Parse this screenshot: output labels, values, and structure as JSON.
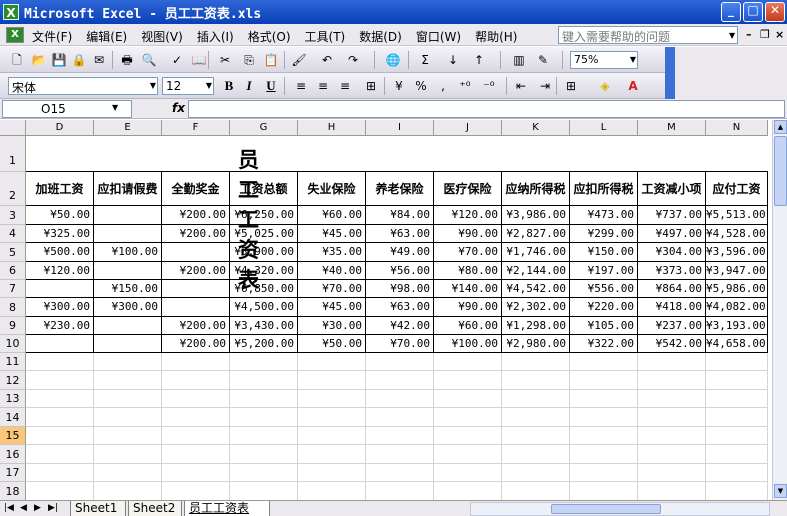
{
  "window": {
    "title": "Microsoft Excel - 员工工资表.xls",
    "icon_glyph": "X",
    "minimize_glyph": "_",
    "maximize_glyph": "□",
    "close_glyph": "✕"
  },
  "menu": {
    "items": [
      "文件(F)",
      "编辑(E)",
      "视图(V)",
      "插入(I)",
      "格式(O)",
      "工具(T)",
      "数据(D)",
      "窗口(W)",
      "帮助(H)"
    ],
    "help_placeholder": "键入需要帮助的问题",
    "mdi_minimize": "–",
    "mdi_restore": "❐",
    "mdi_close": "×"
  },
  "toolbar": {
    "zoom": "75%",
    "font": "宋体",
    "font_size": "12",
    "standard_icons": [
      {
        "name": "new-icon",
        "glyph": "🗋"
      },
      {
        "name": "open-icon",
        "glyph": "📂"
      },
      {
        "name": "save-icon",
        "glyph": "💾"
      },
      {
        "name": "permission-icon",
        "glyph": "🔒"
      },
      {
        "name": "email-icon",
        "glyph": "✉"
      },
      {
        "name": "print-icon",
        "glyph": "🖶"
      },
      {
        "name": "print-preview-icon",
        "glyph": "🔍"
      },
      {
        "name": "spelling-icon",
        "glyph": "✓"
      },
      {
        "name": "research-icon",
        "glyph": "📖"
      },
      {
        "name": "cut-icon",
        "glyph": "✂"
      },
      {
        "name": "copy-icon",
        "glyph": "⎘"
      },
      {
        "name": "paste-icon",
        "glyph": "📋"
      },
      {
        "name": "format-painter-icon",
        "glyph": "🖌"
      },
      {
        "name": "undo-icon",
        "glyph": "↶"
      },
      {
        "name": "redo-icon",
        "glyph": "↷"
      },
      {
        "name": "hyperlink-icon",
        "glyph": "🌐"
      },
      {
        "name": "autosum-icon",
        "glyph": "Σ"
      },
      {
        "name": "sort-ascending-icon",
        "glyph": "↓"
      },
      {
        "name": "sort-descending-icon",
        "glyph": "↑"
      },
      {
        "name": "chart-wizard-icon",
        "glyph": "▥"
      },
      {
        "name": "drawing-icon",
        "glyph": "✎"
      },
      {
        "name": "help-icon",
        "glyph": "?"
      }
    ],
    "format_icons": [
      {
        "name": "bold-icon",
        "glyph": "B"
      },
      {
        "name": "italic-icon",
        "glyph": "I"
      },
      {
        "name": "underline-icon",
        "glyph": "U"
      },
      {
        "name": "align-left-icon",
        "glyph": "≡"
      },
      {
        "name": "align-center-icon",
        "glyph": "≡"
      },
      {
        "name": "align-right-icon",
        "glyph": "≡"
      },
      {
        "name": "merge-center-icon",
        "glyph": "⊞"
      },
      {
        "name": "currency-icon",
        "glyph": "¥"
      },
      {
        "name": "percent-icon",
        "glyph": "%"
      },
      {
        "name": "comma-icon",
        "glyph": ","
      },
      {
        "name": "increase-decimal-icon",
        "glyph": "⁺⁰"
      },
      {
        "name": "decrease-decimal-icon",
        "glyph": "⁻⁰"
      },
      {
        "name": "decrease-indent-icon",
        "glyph": "⇤"
      },
      {
        "name": "increase-indent-icon",
        "glyph": "⇥"
      },
      {
        "name": "borders-icon",
        "glyph": "⊞"
      },
      {
        "name": "fill-color-icon",
        "glyph": "◈"
      },
      {
        "name": "font-color-icon",
        "glyph": "A"
      }
    ],
    "accent_red": "#d02020"
  },
  "formula_bar": {
    "name_box": "O15",
    "fx": "fx",
    "value": ""
  },
  "sheet": {
    "column_letters": [
      "D",
      "E",
      "F",
      "G",
      "H",
      "I",
      "J",
      "K",
      "L",
      "M",
      "N"
    ],
    "row_numbers": [
      "1",
      "2",
      "3",
      "4",
      "5",
      "6",
      "7",
      "8",
      "9",
      "10",
      "11",
      "12",
      "13",
      "14",
      "15",
      "16",
      "17",
      "18"
    ],
    "selected_row": "15",
    "title": "员工工资表",
    "headers": [
      "加班工资",
      "应扣请假费",
      "全勤奖金",
      "工资总额",
      "失业保险",
      "养老保险",
      "医疗保险",
      "应纳所得税",
      "应扣所得税",
      "工资减小项",
      "应付工资"
    ],
    "rows": [
      [
        "¥50.00",
        "",
        "¥200.00",
        "¥6,250.00",
        "¥60.00",
        "¥84.00",
        "¥120.00",
        "¥3,986.00",
        "¥473.00",
        "¥737.00",
        "¥5,513.00"
      ],
      [
        "¥325.00",
        "",
        "¥200.00",
        "¥5,025.00",
        "¥45.00",
        "¥63.00",
        "¥90.00",
        "¥2,827.00",
        "¥299.00",
        "¥497.00",
        "¥4,528.00"
      ],
      [
        "¥500.00",
        "¥100.00",
        "",
        "¥3,900.00",
        "¥35.00",
        "¥49.00",
        "¥70.00",
        "¥1,746.00",
        "¥150.00",
        "¥304.00",
        "¥3,596.00"
      ],
      [
        "¥120.00",
        "",
        "¥200.00",
        "¥4,320.00",
        "¥40.00",
        "¥56.00",
        "¥80.00",
        "¥2,144.00",
        "¥197.00",
        "¥373.00",
        "¥3,947.00"
      ],
      [
        "",
        "¥150.00",
        "",
        "¥6,850.00",
        "¥70.00",
        "¥98.00",
        "¥140.00",
        "¥4,542.00",
        "¥556.00",
        "¥864.00",
        "¥5,986.00"
      ],
      [
        "¥300.00",
        "¥300.00",
        "",
        "¥4,500.00",
        "¥45.00",
        "¥63.00",
        "¥90.00",
        "¥2,302.00",
        "¥220.00",
        "¥418.00",
        "¥4,082.00"
      ],
      [
        "¥230.00",
        "",
        "¥200.00",
        "¥3,430.00",
        "¥30.00",
        "¥42.00",
        "¥60.00",
        "¥1,298.00",
        "¥105.00",
        "¥237.00",
        "¥3,193.00"
      ],
      [
        "",
        "",
        "¥200.00",
        "¥5,200.00",
        "¥50.00",
        "¥70.00",
        "¥100.00",
        "¥2,980.00",
        "¥322.00",
        "¥542.00",
        "¥4,658.00"
      ]
    ]
  },
  "tabs": {
    "items": [
      "Sheet1",
      "Sheet2",
      "员工工资表"
    ],
    "active": "员工工资表",
    "nav": [
      "|◀",
      "◀",
      "▶",
      "▶|"
    ]
  },
  "scroll": {
    "up": "▲",
    "down": "▼"
  }
}
